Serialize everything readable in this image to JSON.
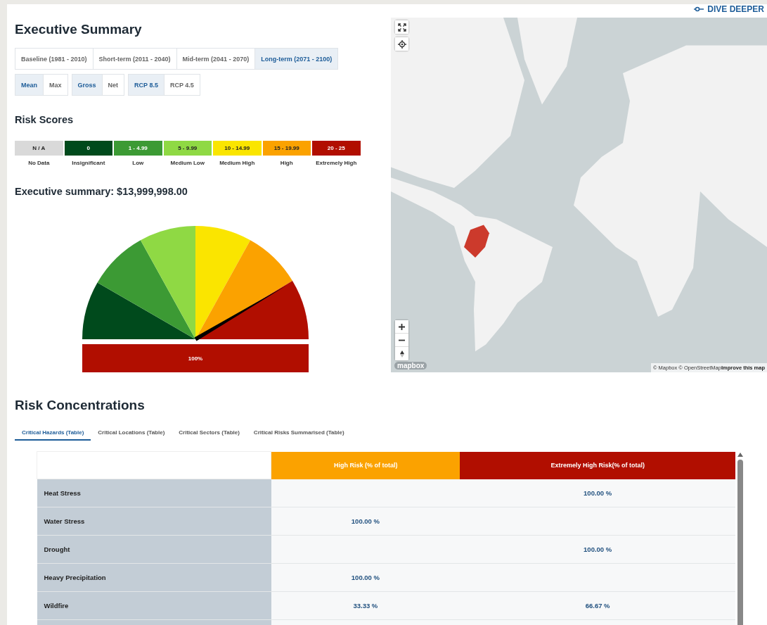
{
  "title": "Executive Summary",
  "periods": [
    {
      "label": "Baseline (1981 - 2010)",
      "selected": false
    },
    {
      "label": "Short-term (2011 - 2040)",
      "selected": false
    },
    {
      "label": "Mid-term (2041 - 2070)",
      "selected": false
    },
    {
      "label": "Long-term (2071 - 2100)",
      "selected": true
    }
  ],
  "toggle_groups": [
    [
      {
        "label": "Mean",
        "selected": true
      },
      {
        "label": "Max",
        "selected": false
      }
    ],
    [
      {
        "label": "Gross",
        "selected": true
      },
      {
        "label": "Net",
        "selected": false
      }
    ],
    [
      {
        "label": "RCP 8.5",
        "selected": true
      },
      {
        "label": "RCP 4.5",
        "selected": false
      }
    ]
  ],
  "risk_scores": {
    "title": "Risk Scores",
    "bands": [
      {
        "range": "N / A",
        "label": "No Data",
        "color": "#d9d9d9"
      },
      {
        "range": "0",
        "label": "Insignificant",
        "color": "#004a1c"
      },
      {
        "range": "1 - 4.99",
        "label": "Low",
        "color": "#3c9a34"
      },
      {
        "range": "5 - 9.99",
        "label": "Medium Low",
        "color": "#8fd944"
      },
      {
        "range": "10 - 14.99",
        "label": "Medium High",
        "color": "#fae500"
      },
      {
        "range": "15 - 19.99",
        "label": "High",
        "color": "#fba200"
      },
      {
        "range": "20 - 25",
        "label": "Extremely High",
        "color": "#b10e00"
      }
    ]
  },
  "summary": {
    "title": "Executive summary: $13,999,998.00"
  },
  "gauge": {
    "level": 0.83,
    "reading": "100%"
  },
  "map": {
    "dive_deeper": "DIVE DEEPER",
    "logo": "mapbox",
    "attribution": "© Mapbox © OpenStreetMap",
    "improve_link": "Improve this map"
  },
  "concentrations": {
    "title": "Risk Concentrations",
    "tabs": [
      {
        "label": "Critical Hazards (Table)",
        "selected": true
      },
      {
        "label": "Critical Locations (Table)",
        "selected": false
      },
      {
        "label": "Critical Sectors (Table)",
        "selected": false
      },
      {
        "label": "Critical Risks Summarised (Table)",
        "selected": false
      }
    ],
    "columns": [
      "High Risk (% of total)",
      "Extremely High Risk(% of total)"
    ],
    "rows": [
      {
        "name": "Heat Stress",
        "extremely_high": "100.00 %"
      },
      {
        "name": "Water Stress",
        "high": "100.00 %"
      },
      {
        "name": "Drought",
        "extremely_high": "100.00 %"
      },
      {
        "name": "Heavy Precipitation",
        "high": "100.00 %"
      },
      {
        "name": "Wildfire",
        "high": "33.33 %",
        "extremely_high": "66.67 %"
      }
    ]
  }
}
